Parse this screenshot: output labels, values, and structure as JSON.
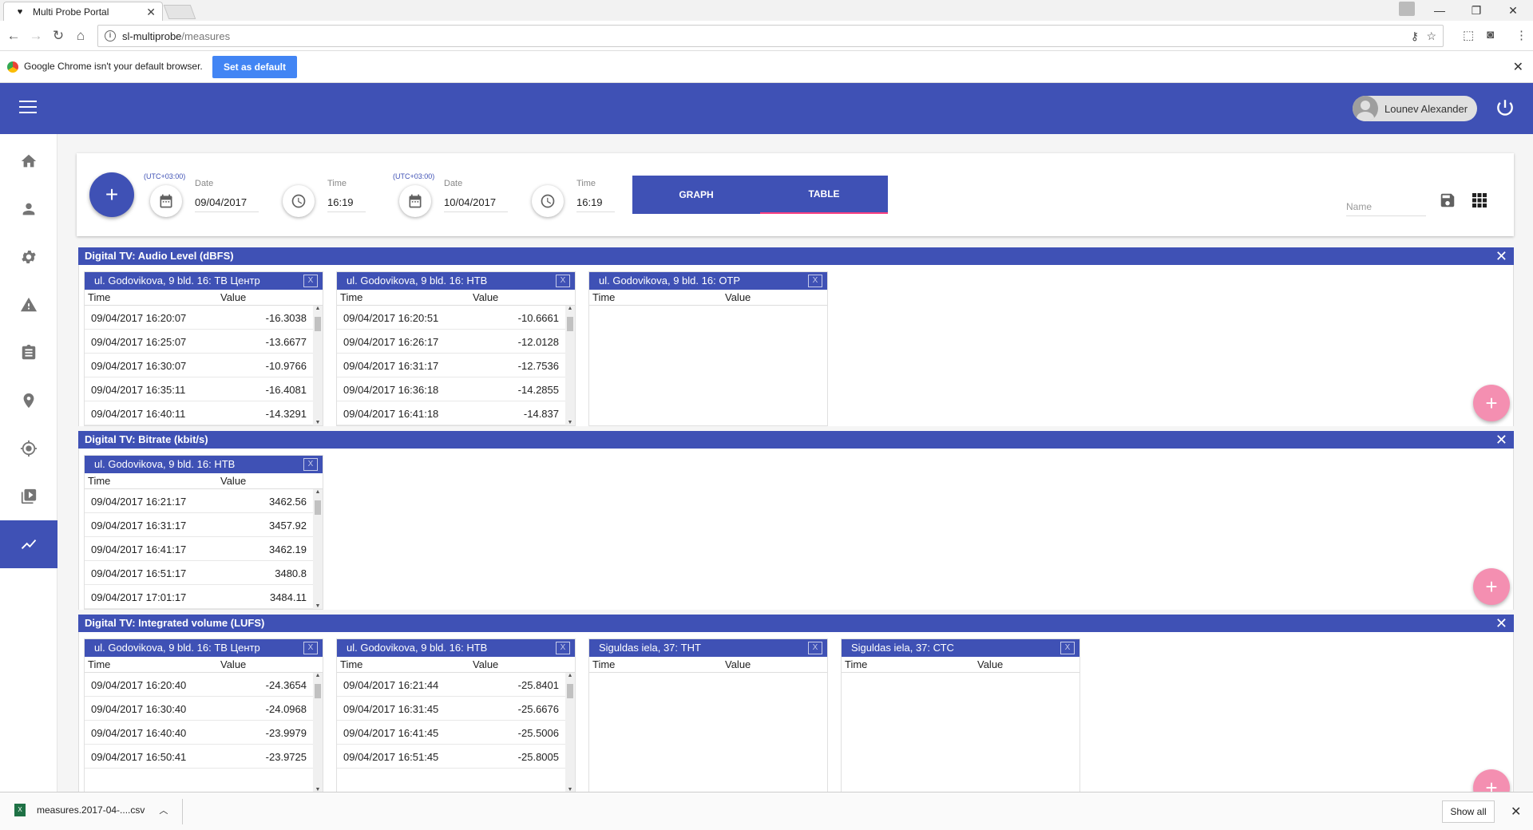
{
  "browser": {
    "tab_title": "Multi Probe Portal",
    "tab_close": "✕",
    "url_host": "sl-multiprobe",
    "url_path": "/measures",
    "infobar_message": "Google Chrome isn't your default browser.",
    "infobar_button": "Set as default"
  },
  "header": {
    "user_name": "Lounev Alexander"
  },
  "filter": {
    "start": {
      "tz": "(UTC+03:00)",
      "date_label": "Date",
      "date": "09/04/2017",
      "time_label": "Time",
      "time": "16:19"
    },
    "end": {
      "tz": "(UTC+03:00)",
      "date_label": "Date",
      "date": "10/04/2017",
      "time_label": "Time",
      "time": "16:19"
    },
    "toggle": {
      "graph": "GRAPH",
      "table": "TABLE",
      "active": "table"
    },
    "name_placeholder": "Name"
  },
  "sections": [
    {
      "title": "Digital TV: Audio Level (dBFS)",
      "tables": [
        {
          "title": "ul. Godovikova, 9 bld. 16: ТВ Центр",
          "col_time": "Time",
          "col_value": "Value",
          "rows": [
            [
              "09/04/2017 16:20:07",
              "-16.3038"
            ],
            [
              "09/04/2017 16:25:07",
              "-13.6677"
            ],
            [
              "09/04/2017 16:30:07",
              "-10.9766"
            ],
            [
              "09/04/2017 16:35:11",
              "-16.4081"
            ],
            [
              "09/04/2017 16:40:11",
              "-14.3291"
            ]
          ]
        },
        {
          "title": "ul. Godovikova, 9 bld. 16: НТВ",
          "col_time": "Time",
          "col_value": "Value",
          "rows": [
            [
              "09/04/2017 16:20:51",
              "-10.6661"
            ],
            [
              "09/04/2017 16:26:17",
              "-12.0128"
            ],
            [
              "09/04/2017 16:31:17",
              "-12.7536"
            ],
            [
              "09/04/2017 16:36:18",
              "-14.2855"
            ],
            [
              "09/04/2017 16:41:18",
              "-14.837"
            ]
          ]
        },
        {
          "title": "ul. Godovikova, 9 bld. 16: ОТР",
          "col_time": "Time",
          "col_value": "Value",
          "rows": []
        }
      ]
    },
    {
      "title": "Digital TV: Bitrate (kbit/s)",
      "tables": [
        {
          "title": "ul. Godovikova, 9 bld. 16: НТВ",
          "col_time": "Time",
          "col_value": "Value",
          "rows": [
            [
              "09/04/2017 16:21:17",
              "3462.56"
            ],
            [
              "09/04/2017 16:31:17",
              "3457.92"
            ],
            [
              "09/04/2017 16:41:17",
              "3462.19"
            ],
            [
              "09/04/2017 16:51:17",
              "3480.8"
            ],
            [
              "09/04/2017 17:01:17",
              "3484.11"
            ]
          ]
        }
      ]
    },
    {
      "title": "Digital TV: Integrated volume (LUFS)",
      "tables": [
        {
          "title": "ul. Godovikova, 9 bld. 16: ТВ Центр",
          "col_time": "Time",
          "col_value": "Value",
          "rows": [
            [
              "09/04/2017 16:20:40",
              "-24.3654"
            ],
            [
              "09/04/2017 16:30:40",
              "-24.0968"
            ],
            [
              "09/04/2017 16:40:40",
              "-23.9979"
            ],
            [
              "09/04/2017 16:50:41",
              "-23.9725"
            ]
          ]
        },
        {
          "title": "ul. Godovikova, 9 bld. 16: НТВ",
          "col_time": "Time",
          "col_value": "Value",
          "rows": [
            [
              "09/04/2017 16:21:44",
              "-25.8401"
            ],
            [
              "09/04/2017 16:31:45",
              "-25.6676"
            ],
            [
              "09/04/2017 16:41:45",
              "-25.5006"
            ],
            [
              "09/04/2017 16:51:45",
              "-25.8005"
            ]
          ]
        },
        {
          "title": "Siguldas iela, 37: ТНТ",
          "col_time": "Time",
          "col_value": "Value",
          "rows": []
        },
        {
          "title": "Siguldas iela, 37: СТС",
          "col_time": "Time",
          "col_value": "Value",
          "rows": []
        }
      ]
    }
  ],
  "downloads": {
    "file_name": "measures.2017-04-....csv",
    "show_all": "Show all"
  },
  "colors": {
    "primary": "#3f51b5",
    "accent": "#ff4081",
    "fab_pink": "#f48fb1"
  }
}
